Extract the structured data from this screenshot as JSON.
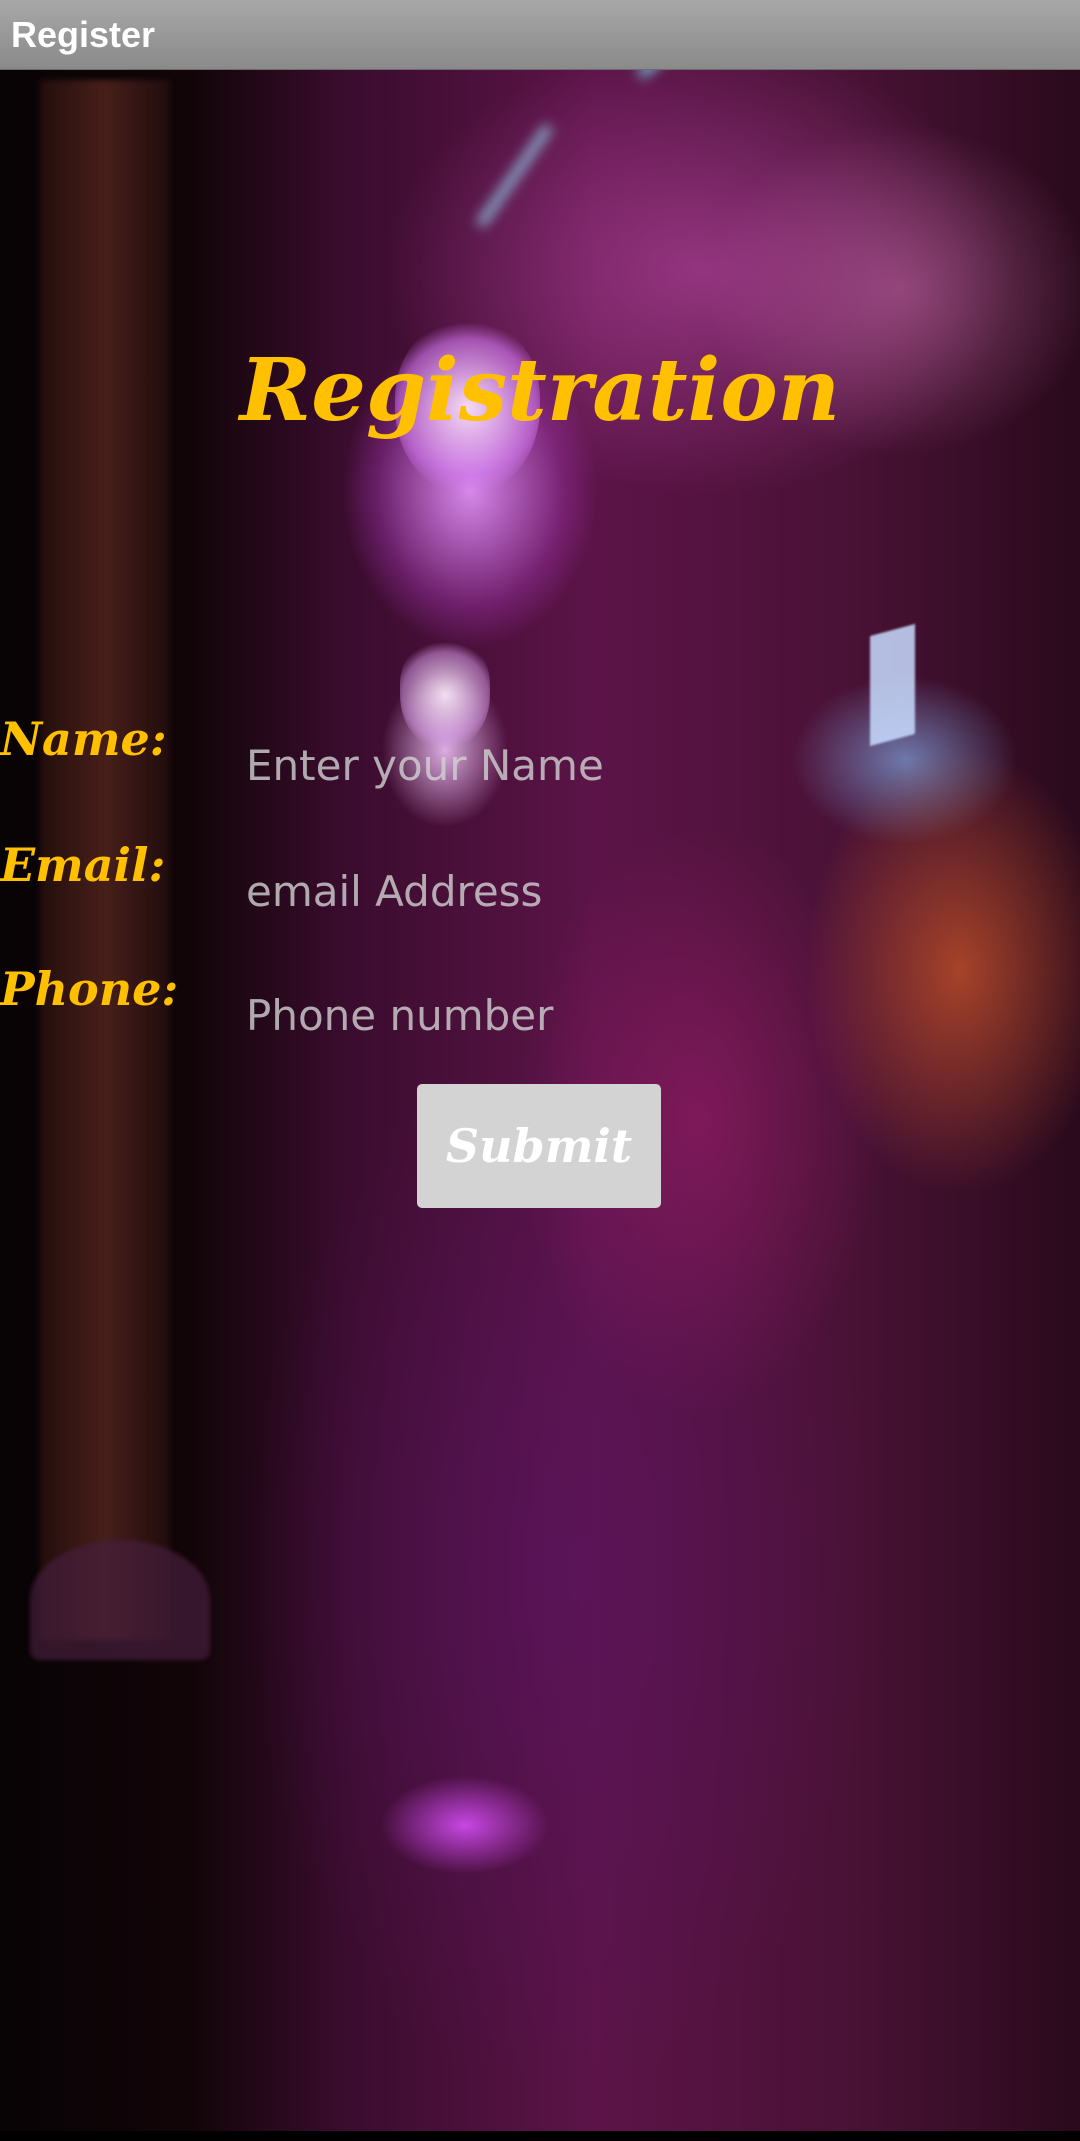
{
  "app_bar": {
    "title": "Register"
  },
  "form": {
    "heading": "Registration",
    "fields": [
      {
        "label": "Name:",
        "placeholder": "Enter your Name",
        "value": ""
      },
      {
        "label": "Email:",
        "placeholder": "email Address",
        "value": ""
      },
      {
        "label": "Phone:",
        "placeholder": "Phone number",
        "value": ""
      }
    ],
    "submit_label": "Submit"
  },
  "colors": {
    "accent": "#ffc000",
    "app_bar": "#9a9a9a",
    "button": "#d3d3d3",
    "placeholder": "#cccccc"
  }
}
